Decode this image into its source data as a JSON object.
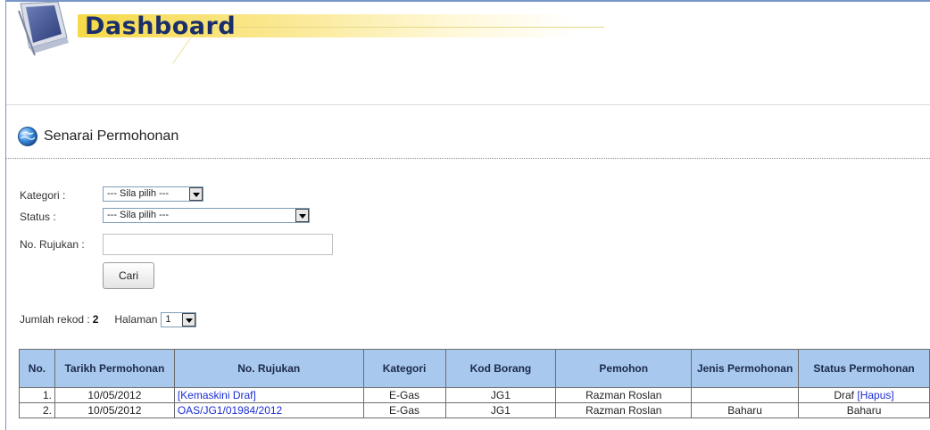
{
  "header": {
    "title": "Dashboard"
  },
  "section": {
    "title": "Senarai Permohonan"
  },
  "filters": {
    "kategori_label": "Kategori :",
    "kategori_value": "--- Sila pilih ---",
    "status_label": "Status :",
    "status_value": "--- Sila pilih ---",
    "rujukan_label": "No. Rujukan :",
    "rujukan_value": "",
    "search_button": "Cari"
  },
  "summary": {
    "records_label": "Jumlah rekod :",
    "records_count": "2",
    "page_label": "Halaman",
    "page_value": "1"
  },
  "table": {
    "columns": [
      "No.",
      "Tarikh Permohonan",
      "No. Rujukan",
      "Kategori",
      "Kod Borang",
      "Pemohon",
      "Jenis Permohonan",
      "Status Permohonan"
    ],
    "rows": [
      {
        "no": "1.",
        "tarikh": "10/05/2012",
        "rujukan": "[Kemaskini Draf]",
        "kategori": "E-Gas",
        "kod": "JG1",
        "pemohon": "Razman Roslan",
        "jenis": "",
        "status": "Draf",
        "status_link": "[Hapus]"
      },
      {
        "no": "2.",
        "tarikh": "10/05/2012",
        "rujukan": "OAS/JG1/01984/2012",
        "kategori": "E-Gas",
        "kod": "JG1",
        "pemohon": "Razman Roslan",
        "jenis": "Baharu",
        "status": "Baharu",
        "status_link": ""
      }
    ]
  },
  "icons": {
    "banner": "tablet-pc-icon",
    "section": "globe-icon"
  },
  "colors": {
    "table_header_bg": "#a9c8ee",
    "title": "#1a2f6a",
    "link": "#1a2dd6",
    "banner_accent": "#f5d947"
  }
}
